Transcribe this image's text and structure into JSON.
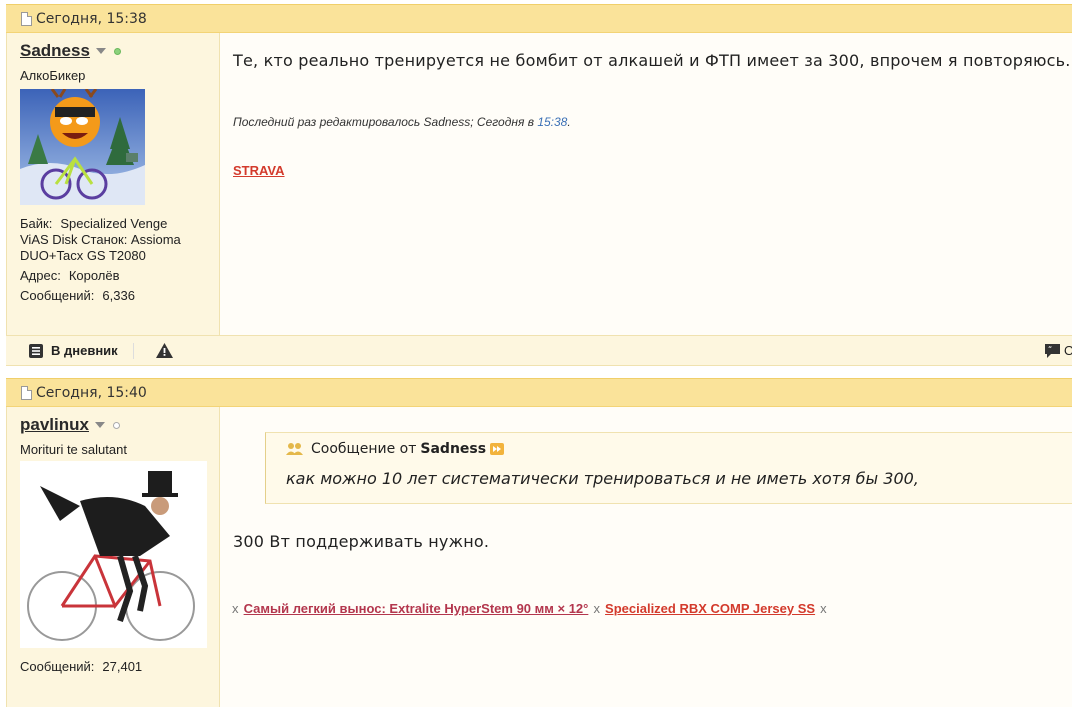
{
  "posts": [
    {
      "date": "Сегодня, 15:38",
      "username": "Sadness",
      "user_title": "АлкоБикер",
      "info": {
        "bike_label": "Байк:",
        "bike_value": "Specialized Venge",
        "bike_cont1": "ViAS Disk Станок: Assioma",
        "bike_cont2": "DUO+Tacx GS T2080",
        "address_label": "Адрес:",
        "address_value": "Королёв",
        "posts_label": "Сообщений:",
        "posts_value": "6,336"
      },
      "text": "Те, кто реально тренируется не бомбит от алкашей и ФТП имеет за 300, впрочем я повторяюсь.",
      "edit_prefix": "Последний раз редактировалось Sadness; Сегодня в",
      "edit_time": "15:38",
      "edit_suffix": ".",
      "signature_link": "STRAVA",
      "footer": {
        "diary_label": "В дневник",
        "reply_partial": "О"
      }
    },
    {
      "date": "Сегодня, 15:40",
      "username": "pavlinux",
      "user_title": "Morituri te salutant",
      "info": {
        "posts_label": "Сообщений:",
        "posts_value": "27,401"
      },
      "quote": {
        "label": "Сообщение от",
        "author": "Sadness",
        "text": "как можно 10 лет систематически тренироваться и не иметь хотя бы 300,"
      },
      "text": "300 Вт поддерживать нужно.",
      "signature": {
        "x": "x",
        "link1": "Самый легкий вынос: Extralite HyperStem 90 мм × 12°",
        "link2": "Specialized RBX COMP Jersey SS"
      }
    }
  ],
  "colors": {
    "header_bg": "#fae39a",
    "user_bg": "#fdf6de",
    "link_red": "#d33a2c",
    "link_dark": "#b3364d"
  }
}
